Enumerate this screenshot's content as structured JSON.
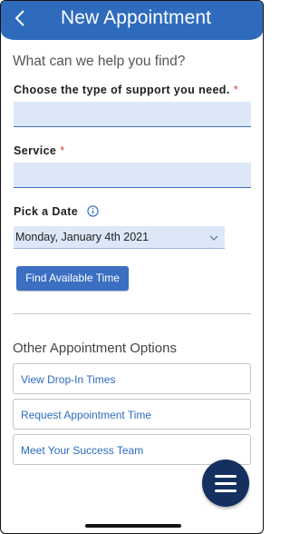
{
  "header": {
    "title": "New Appointment",
    "back_icon": "chevron-left-icon",
    "color": "#2e6bbd"
  },
  "main": {
    "help_text": "What can we help you find?",
    "support_type": {
      "label": "Choose the type of support you need.",
      "required_mark": "*",
      "value": "",
      "placeholder": ""
    },
    "service": {
      "label": "Service",
      "required_mark": "*",
      "value": "",
      "placeholder": ""
    },
    "date": {
      "label": "Pick a Date",
      "info_icon": "info-icon",
      "selected": "Monday, January 4th 2021"
    },
    "find_button": "Find Available Time"
  },
  "other_options": {
    "title": "Other Appointment Options",
    "items": [
      {
        "label": "View Drop-In Times"
      },
      {
        "label": "Request Appointment Time"
      },
      {
        "label": "Meet Your Success Team"
      }
    ]
  },
  "fab": {
    "icon": "menu-icon",
    "color": "#14305e"
  },
  "colors": {
    "accent": "#2e6bbd",
    "required": "#d9403b",
    "field_background": "#dce8f8"
  }
}
